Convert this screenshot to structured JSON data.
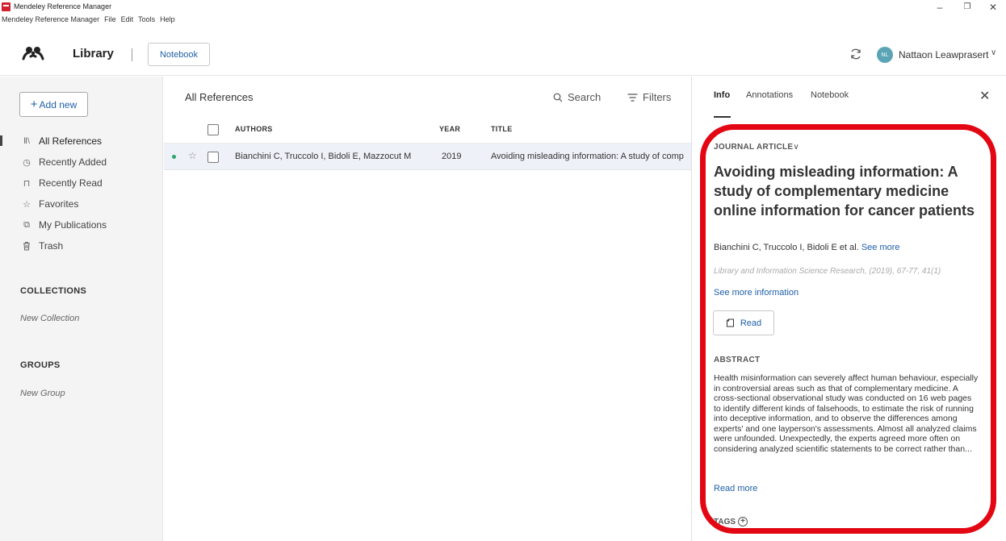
{
  "window": {
    "title": "Mendeley Reference Manager",
    "controls": {
      "minimize": "–",
      "maximize": "❐",
      "close": "✕"
    }
  },
  "menu": [
    "Mendeley Reference Manager",
    "File",
    "Edit",
    "Tools",
    "Help"
  ],
  "header": {
    "library_title": "Library",
    "notebook_button": "Notebook",
    "user_initials": "NL",
    "user_name": "Nattaon Leawprasert",
    "user_chevron": "∨"
  },
  "sidebar": {
    "add_new_label": "Add new",
    "add_new_plus": "+",
    "items": [
      {
        "label": "All References",
        "icon": "library-books-icon",
        "glyph": "Ⅱ\\"
      },
      {
        "label": "Recently Added",
        "icon": "clock-icon",
        "glyph": "◷"
      },
      {
        "label": "Recently Read",
        "icon": "bookmark-icon",
        "glyph": "⊓"
      },
      {
        "label": "Favorites",
        "icon": "star-icon",
        "glyph": "☆"
      },
      {
        "label": "My Publications",
        "icon": "publications-icon",
        "glyph": "⧉"
      },
      {
        "label": "Trash",
        "icon": "trash-icon",
        "glyph": "🗑"
      }
    ],
    "collections_title": "COLLECTIONS",
    "new_collection": "New Collection",
    "groups_title": "GROUPS",
    "new_group": "New Group"
  },
  "main": {
    "title": "All References",
    "search_label": "Search",
    "filters_label": "Filters",
    "columns": {
      "authors": "AUTHORS",
      "year": "YEAR",
      "title": "TITLE"
    },
    "rows": [
      {
        "authors": "Bianchini C, Truccolo I, Bidoli E, Mazzocut M",
        "year": "2019",
        "title": "Avoiding misleading information: A study of comp"
      }
    ]
  },
  "panel": {
    "tabs": [
      "Info",
      "Annotations",
      "Notebook"
    ],
    "active_tab": "Info",
    "close": "✕",
    "article_type": "JOURNAL ARTICLE",
    "article_type_chevron": "∨",
    "title": "Avoiding misleading information: A study of complementary medicine online information for cancer patients",
    "authors": "Bianchini C, Truccolo I, Bidoli E et al.",
    "see_more": "See more",
    "citation": "Library and Information Science Research, (2019), 67-77, 41(1)",
    "more_information": "See more information",
    "read_button": "Read",
    "abstract_title": "ABSTRACT",
    "abstract": "Health misinformation can severely affect human behaviour, especially in controversial areas such as that of complementary medicine. A cross-sectional observational study was conducted on 16 web pages to identify different kinds of falsehoods, to estimate the risk of running into deceptive information, and to observe the differences among experts' and one layperson's assessments. Almost all analyzed claims were unfounded. Unexpectedly, the experts agreed more often on considering analyzed scientific statements to be correct rather than...",
    "read_more": "Read more",
    "tags_label": "TAGS"
  },
  "annotation": {
    "highlight_color": "#e30613"
  }
}
